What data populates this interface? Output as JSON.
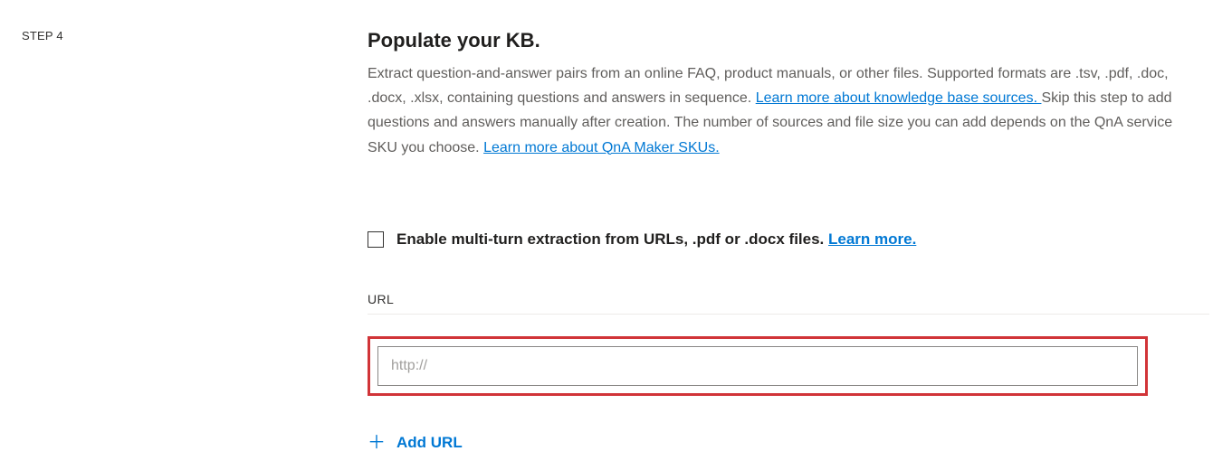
{
  "step": {
    "label": "STEP 4"
  },
  "section": {
    "title": "Populate your KB.",
    "desc1": "Extract question-and-answer pairs from an online FAQ, product manuals, or other files. Supported formats are .tsv, .pdf, .doc, .docx, .xlsx, containing questions and answers in sequence. ",
    "link1": "Learn more about knowledge base sources. ",
    "desc2": "Skip this step to add questions and answers manually after creation. The number of sources and file size you can add depends on the QnA service SKU you choose. ",
    "link2": "Learn more about QnA Maker SKUs."
  },
  "multiturn": {
    "label": "Enable multi-turn extraction from URLs, .pdf or .docx files. ",
    "learn_more": "Learn more."
  },
  "url": {
    "header": "URL",
    "placeholder": "http://",
    "value": ""
  },
  "add_url": {
    "label": "Add URL"
  }
}
